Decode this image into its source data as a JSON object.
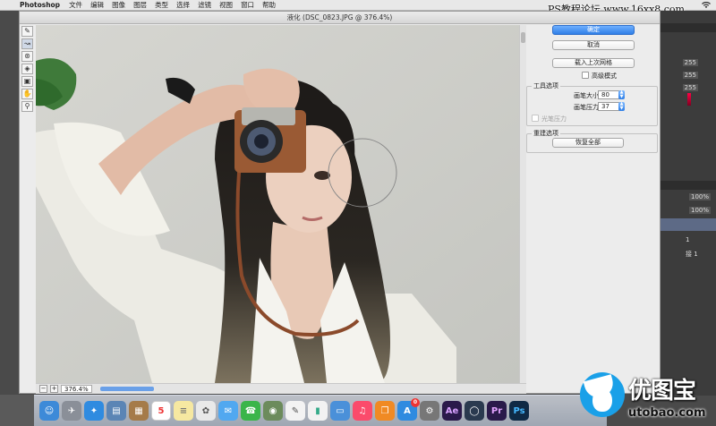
{
  "menubar": {
    "app": "Photoshop",
    "items": [
      "文件",
      "编辑",
      "图像",
      "图层",
      "类型",
      "选择",
      "滤镜",
      "视图",
      "窗口",
      "帮助"
    ]
  },
  "watermark_top": "PS教程论坛 www.16xx8.com",
  "dialog": {
    "title": "液化 (DSC_0823.JPG @ 376.4%)",
    "tools": [
      "brush-icon",
      "forward-warp-icon",
      "pucker-icon",
      "bloat-icon",
      "mask-icon",
      "hand-icon",
      "zoom-icon"
    ],
    "zoom_level": "376.4%"
  },
  "options": {
    "ok": "确定",
    "cancel": "取消",
    "load_mesh": "载入上次网格",
    "advanced_mode": "高级模式",
    "tool_options_title": "工具选项",
    "brush_size_label": "画笔大小:",
    "brush_size": "80",
    "brush_pressure_label": "画笔压力:",
    "brush_pressure": "37",
    "stylus_pressure": "光笔压力",
    "reconstruct_title": "重建选项",
    "restore_all": "恢复全部"
  },
  "bg_panel": {
    "values": [
      "255",
      "255",
      "255"
    ],
    "percents": [
      "100%",
      "100%"
    ],
    "layer_texts": [
      "1",
      "接 1"
    ]
  },
  "dock": {
    "calendar_day": "5",
    "badge": "0",
    "apps": [
      "Ae",
      "Pr",
      "Ps"
    ]
  },
  "watermark": {
    "brand": "优图宝",
    "url": "utobao.com"
  }
}
